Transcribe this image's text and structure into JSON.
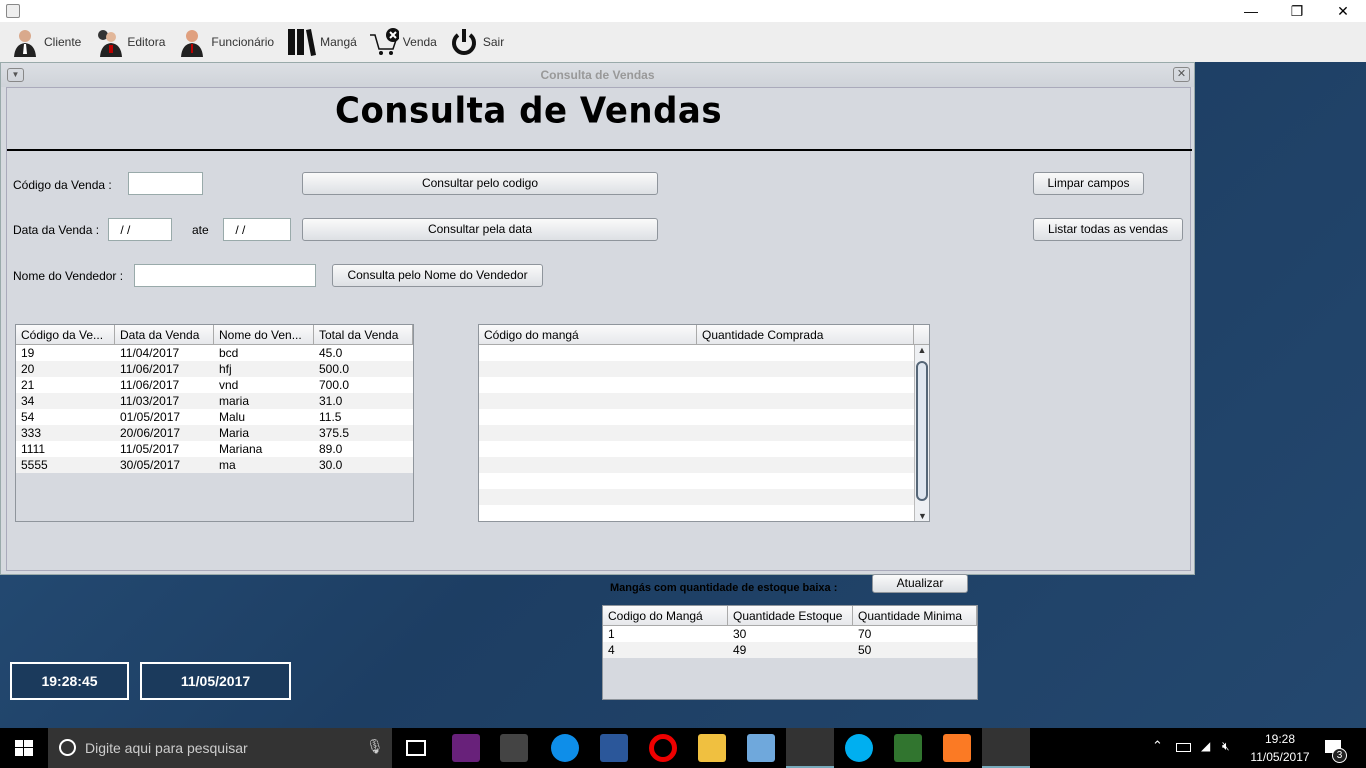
{
  "window": {
    "minimize": "—",
    "maximize": "❐",
    "close": "✕"
  },
  "toolbar": [
    {
      "label": "Cliente",
      "icon": "person-icon"
    },
    {
      "label": "Editora",
      "icon": "people-icon"
    },
    {
      "label": "Funcionário",
      "icon": "employee-icon"
    },
    {
      "label": "Mangá",
      "icon": "books-icon"
    },
    {
      "label": "Venda",
      "icon": "cart-icon"
    },
    {
      "label": "Sair",
      "icon": "power-icon"
    }
  ],
  "frame": {
    "title": "Consulta de Vendas",
    "heading": "Consulta de Vendas"
  },
  "form": {
    "codigo_label": "Código da Venda :",
    "codigo_value": "",
    "btn_codigo": "Consultar pelo codigo",
    "data_label": "Data da Venda :",
    "data_from": " / /",
    "ate": "ate",
    "data_to": " / /",
    "btn_data": "Consultar pela data",
    "vendedor_label": "Nome do Vendedor :",
    "vendedor_value": "",
    "btn_vendedor": "Consulta pelo Nome do Vendedor",
    "btn_limpar": "Limpar campos",
    "btn_listar": "Listar todas as vendas"
  },
  "vendas": {
    "headers": [
      "Código da Ve...",
      "Data da Venda",
      "Nome do Ven...",
      "Total da Venda"
    ],
    "rows": [
      [
        "19",
        "11/04/2017",
        "bcd",
        "45.0"
      ],
      [
        "20",
        "11/06/2017",
        "hfj",
        "500.0"
      ],
      [
        "21",
        "11/06/2017",
        "vnd",
        "700.0"
      ],
      [
        "34",
        "11/03/2017",
        "maria",
        "31.0"
      ],
      [
        "54",
        "01/05/2017",
        "Malu",
        "11.5"
      ],
      [
        "333",
        "20/06/2017",
        "Maria",
        "375.5"
      ],
      [
        "1111",
        "11/05/2017",
        "Mariana",
        "89.0"
      ],
      [
        "5555",
        "30/05/2017",
        "ma",
        "30.0"
      ]
    ]
  },
  "itens": {
    "headers": [
      "Código do mangá",
      "Quantidade Comprada"
    ]
  },
  "estoque": {
    "title": "Mangás com quantidade de estoque baixa :",
    "btn": "Atualizar",
    "headers": [
      "Codigo do Mangá",
      "Quantidade Estoque",
      "Quantidade Minima"
    ],
    "rows": [
      [
        "1",
        "30",
        "70"
      ],
      [
        "4",
        "49",
        "50"
      ]
    ]
  },
  "clock": {
    "time": "19:28:45",
    "date": "11/05/2017"
  },
  "taskbar": {
    "search": "Digite aqui para pesquisar",
    "time": "19:28",
    "date": "11/05/2017",
    "notifications": "3"
  }
}
